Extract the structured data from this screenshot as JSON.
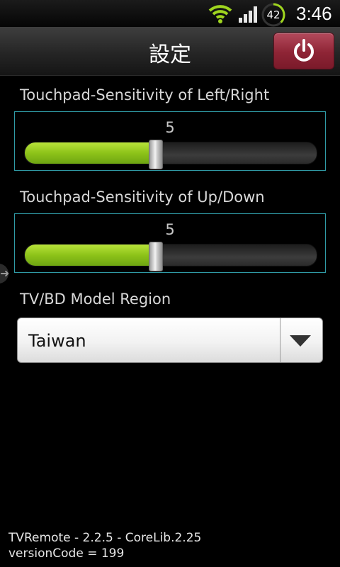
{
  "status_bar": {
    "battery_level": "42",
    "time": "3:46"
  },
  "header": {
    "title": "設定"
  },
  "settings": {
    "horizontal": {
      "label": "Touchpad-Sensitivity of Left/Right",
      "value": "5",
      "fill_fraction": 0.45
    },
    "vertical": {
      "label": "Touchpad-Sensitivity of Up/Down",
      "value": "5",
      "fill_fraction": 0.45
    },
    "region": {
      "label": "TV/BD Model Region",
      "selected": "Taiwan"
    }
  },
  "footer": {
    "version_line": "TVRemote - 2.2.5 - CoreLib.2.25",
    "version_code": "versionCode = 199"
  },
  "colors": {
    "slider_fill": "#8dc319",
    "slider_box_border": "#2f9aa5",
    "power_button": "#8e2435"
  },
  "icons": {
    "wifi": "wifi-icon",
    "signal": "signal-icon",
    "battery": "battery-icon",
    "power": "power-icon",
    "dropdown": "dropdown-arrow-icon",
    "edge_handle": "arrow-right-icon"
  }
}
